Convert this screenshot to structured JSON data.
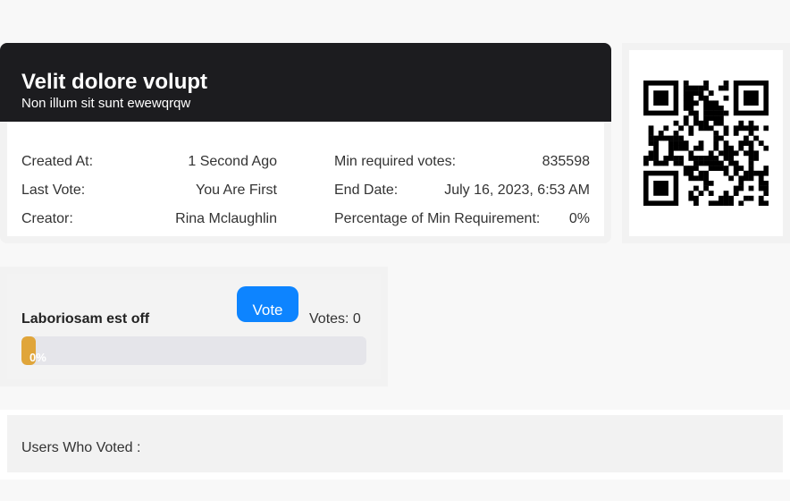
{
  "poll": {
    "title": "Velit dolore volupt",
    "subtitle": "Non illum sit sunt ewewqrqw",
    "details_left": [
      {
        "label": "Created At:",
        "value": "1 Second Ago"
      },
      {
        "label": "Last Vote:",
        "value": "You Are First"
      },
      {
        "label": "Creator:",
        "value": "Rina Mclaughlin"
      }
    ],
    "details_right": [
      {
        "label": "Min required votes:",
        "value": "835598"
      },
      {
        "label": "End Date:",
        "value": "July 16, 2023, 6:53 AM"
      },
      {
        "label": "Percentage of Min Requirement:",
        "value": "0%"
      }
    ]
  },
  "qr": {
    "icon": "qr-code-icon"
  },
  "option": {
    "name": "Laboriosam est off",
    "vote_label": "Vote",
    "votes_text": "Votes: 0",
    "progress_label": "0%",
    "progress_percent": 0,
    "fill_color": "#e0a53a"
  },
  "voters": {
    "title": "Users Who Voted :"
  },
  "colors": {
    "header_bg": "#1c1c1f",
    "accent": "#0d84ff"
  }
}
